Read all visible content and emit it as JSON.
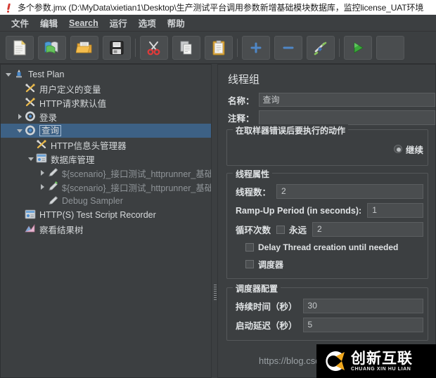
{
  "window": {
    "title": "多个参数.jmx (D:\\MyData\\xietian1\\Desktop\\生产测试平台调用参数新增基础模块数据库，监控license_UAT环境",
    "title_icon": "jmeter-feather-icon"
  },
  "menubar": {
    "items": [
      {
        "label": "文件",
        "mnemonic": ""
      },
      {
        "label": "编辑",
        "mnemonic": ""
      },
      {
        "label": "Search",
        "mnemonic": "S"
      },
      {
        "label": "运行",
        "mnemonic": ""
      },
      {
        "label": "选项",
        "mnemonic": ""
      },
      {
        "label": "帮助",
        "mnemonic": ""
      }
    ]
  },
  "toolbar": {
    "buttons": [
      {
        "name": "new-test-plan-button",
        "icon": "new-document-icon"
      },
      {
        "name": "templates-button",
        "icon": "templates-icon"
      },
      {
        "name": "open-button",
        "icon": "open-folder-icon"
      },
      {
        "name": "save-button",
        "icon": "floppy-save-icon"
      },
      {
        "name": "cut-button",
        "icon": "scissors-cut-icon"
      },
      {
        "name": "copy-button",
        "icon": "copy-pages-icon"
      },
      {
        "name": "paste-button",
        "icon": "clipboard-paste-icon"
      },
      {
        "name": "expand-all-button",
        "icon": "plus-icon"
      },
      {
        "name": "collapse-all-button",
        "icon": "minus-icon"
      },
      {
        "name": "toggle-button",
        "icon": "toggle-wand-icon"
      },
      {
        "name": "start-button",
        "icon": "green-play-icon"
      }
    ]
  },
  "tree": {
    "items": [
      {
        "label": "Test Plan",
        "twist": "down",
        "icon": "test-plan-icon",
        "indent": 0,
        "selected": false,
        "dim": false
      },
      {
        "label": "用户定义的变量",
        "twist": "none",
        "icon": "config-wrench-icon",
        "indent": 1,
        "selected": false,
        "dim": false
      },
      {
        "label": "HTTP请求默认值",
        "twist": "none",
        "icon": "config-wrench-icon",
        "indent": 1,
        "selected": false,
        "dim": false
      },
      {
        "label": "登录",
        "twist": "right",
        "icon": "thread-group-icon",
        "indent": 1,
        "selected": false,
        "dim": false
      },
      {
        "label": "查询",
        "twist": "down",
        "icon": "thread-group-icon",
        "indent": 1,
        "selected": true,
        "dim": false
      },
      {
        "label": "HTTP信息头管理器",
        "twist": "none",
        "icon": "config-wrench-icon",
        "indent": 2,
        "selected": false,
        "dim": false
      },
      {
        "label": "数据库管理",
        "twist": "down",
        "icon": "controller-icon",
        "indent": 2,
        "selected": false,
        "dim": false
      },
      {
        "label": "${scenario}_接口测试_httprunner_基础配置",
        "twist": "right",
        "icon": "sampler-pencil-icon",
        "indent": 3,
        "selected": false,
        "dim": true
      },
      {
        "label": "${scenario}_接口测试_httprunner_基础配置",
        "twist": "right",
        "icon": "sampler-pencil-green-icon",
        "indent": 3,
        "selected": false,
        "dim": true
      },
      {
        "label": "Debug Sampler",
        "twist": "none",
        "icon": "sampler-pencil-icon",
        "indent": 3,
        "selected": false,
        "dim": true
      },
      {
        "label": "HTTP(S) Test Script Recorder",
        "twist": "none",
        "icon": "recorder-icon",
        "indent": 1,
        "selected": false,
        "dim": false
      },
      {
        "label": "察看结果树",
        "twist": "none",
        "icon": "results-tree-icon",
        "indent": 1,
        "selected": false,
        "dim": false
      }
    ]
  },
  "panel": {
    "title": "线程组",
    "name_label": "名称：",
    "name_value": "查询",
    "comment_label": "注释：",
    "comment_value": "",
    "error_action": {
      "group_title": "在取样器错误后要执行的动作",
      "selected_option": "继续"
    },
    "thread_properties": {
      "group_title": "线程属性",
      "threads_label": "线程数：",
      "threads_value": "2",
      "rampup_label": "Ramp-Up Period (in seconds):",
      "rampup_value": "1",
      "loop_label": "循环次数",
      "forever_label": "永远",
      "loop_value": "2",
      "delay_thread_label": "Delay Thread creation until needed",
      "scheduler_label": "调度器"
    },
    "scheduler": {
      "group_title": "调度器配置",
      "duration_label": "持续时间（秒）",
      "duration_value": "30",
      "delay_label": "启动延迟（秒）",
      "delay_value": "5"
    },
    "url_watermark": "https://blog.csd"
  },
  "watermark": {
    "cn": "创新互联",
    "en": "CHUANG XIN HU LIAN",
    "logo": "cx-logo-icon"
  },
  "colors": {
    "window_bg": "#3c3f41",
    "field_bg": "#4a4d4f",
    "selection_blue": "#3d6185",
    "text": "#d6d9db",
    "dim_text": "#8f9498",
    "titlebar_bg": "#ffffff"
  }
}
